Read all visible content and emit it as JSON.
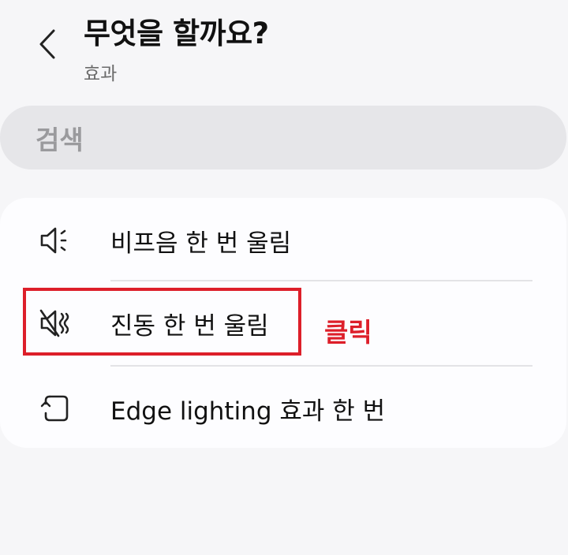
{
  "header": {
    "back_icon": "chevron-left-icon",
    "title": "무엇을 할까요?",
    "subtitle": "효과"
  },
  "search": {
    "placeholder": "검색"
  },
  "options": [
    {
      "icon": "speaker-beep-icon",
      "label": "비프음 한 번 울림"
    },
    {
      "icon": "vibrate-icon",
      "label": "진동 한 번 울림"
    },
    {
      "icon": "edge-lighting-icon",
      "label": "Edge lighting 효과 한 번"
    }
  ],
  "annotation": {
    "click_label": "클릭",
    "color": "#dd1f2a"
  }
}
